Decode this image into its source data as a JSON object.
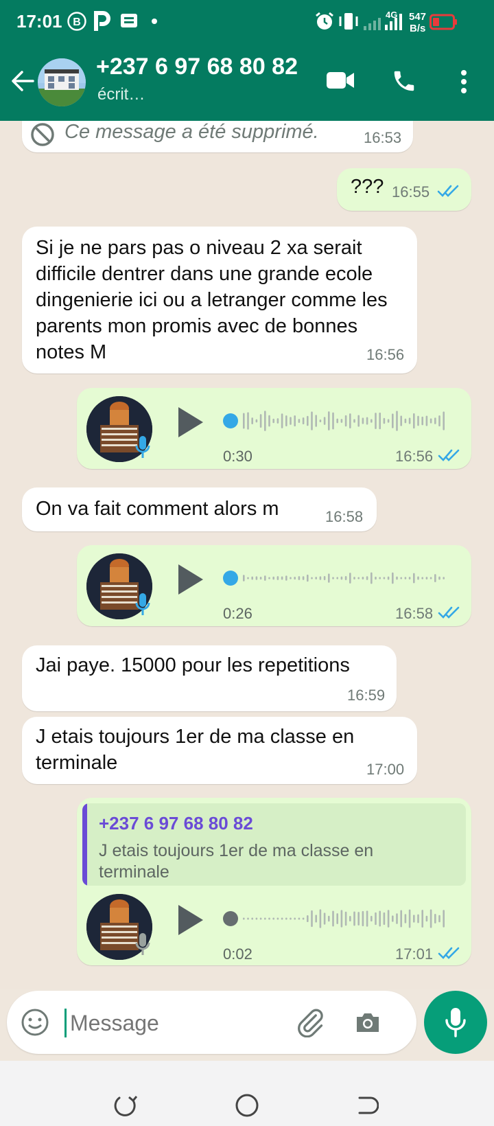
{
  "status": {
    "time": "17:01",
    "net_speed_value": "547",
    "net_speed_unit": "B/s",
    "network": "4G"
  },
  "header": {
    "title": "+237 6 97 68 80 82",
    "subtitle": "écrit…"
  },
  "messages": {
    "deleted": {
      "text": "Ce message a été supprimé.",
      "time": "16:53"
    },
    "m1": {
      "text": "???",
      "time": "16:55"
    },
    "m2": {
      "text": "Si je ne pars pas o niveau 2 xa serait difficile dentrer dans une grande ecole dingenierie ici ou a letranger comme les parents mon promis avec de bonnes notes M",
      "time": "16:56"
    },
    "v1": {
      "duration": "0:30",
      "time": "16:56"
    },
    "m3": {
      "text": "On va fait comment alors m",
      "time": "16:58"
    },
    "v2": {
      "duration": "0:26",
      "time": "16:58"
    },
    "m4": {
      "text": "Jai paye. 15000 pour les repetitions",
      "time": "16:59"
    },
    "m5": {
      "text": "J etais toujours 1er de ma classe en terminale",
      "time": "17:00"
    },
    "v3": {
      "quote_author": "+237 6 97 68 80 82",
      "quote_text": "J etais toujours 1er de ma classe en terminale",
      "duration": "0:02",
      "time": "17:01"
    }
  },
  "composer": {
    "placeholder": "Message"
  },
  "colors": {
    "header": "#047b60",
    "outgoing": "#e5fbd3",
    "incoming": "#ffffff",
    "tick": "#34a8e6",
    "accent": "#069e79",
    "quote_author": "#6a4bd6"
  },
  "icons": [
    "back-arrow-icon",
    "video-call-icon",
    "phone-icon",
    "more-vert-icon",
    "blocked-icon",
    "double-tick-icon",
    "play-icon",
    "mic-icon",
    "emoji-icon",
    "attach-icon",
    "camera-icon"
  ]
}
